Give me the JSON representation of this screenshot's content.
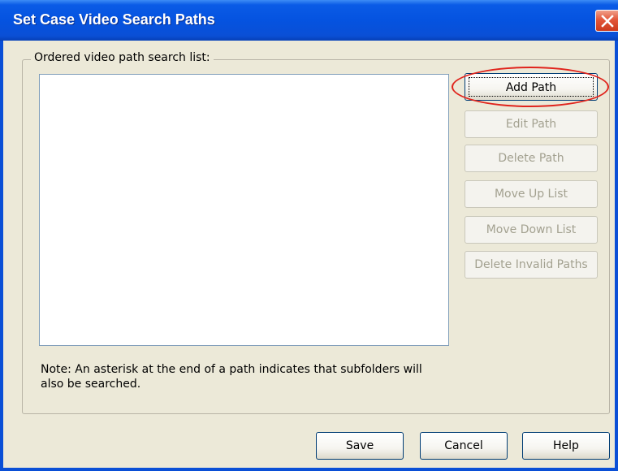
{
  "window": {
    "title": "Set Case Video Search Paths"
  },
  "group": {
    "label": "Ordered video path search list:"
  },
  "path_list": {
    "items": []
  },
  "side_buttons": {
    "add_path": "Add Path",
    "edit_path": "Edit Path",
    "delete_path": "Delete Path",
    "move_up": "Move Up List",
    "move_down": "Move Down List",
    "delete_invalid": "Delete Invalid Paths"
  },
  "note": "Note: An asterisk at the end of a path indicates that subfolders will also be searched.",
  "bottom_buttons": {
    "save": "Save",
    "cancel": "Cancel",
    "help": "Help"
  },
  "colors": {
    "titlebar": "#0553e0",
    "dialog_bg": "#ece9d8",
    "annotation": "#e0241c",
    "disabled_text": "#a3a190"
  }
}
